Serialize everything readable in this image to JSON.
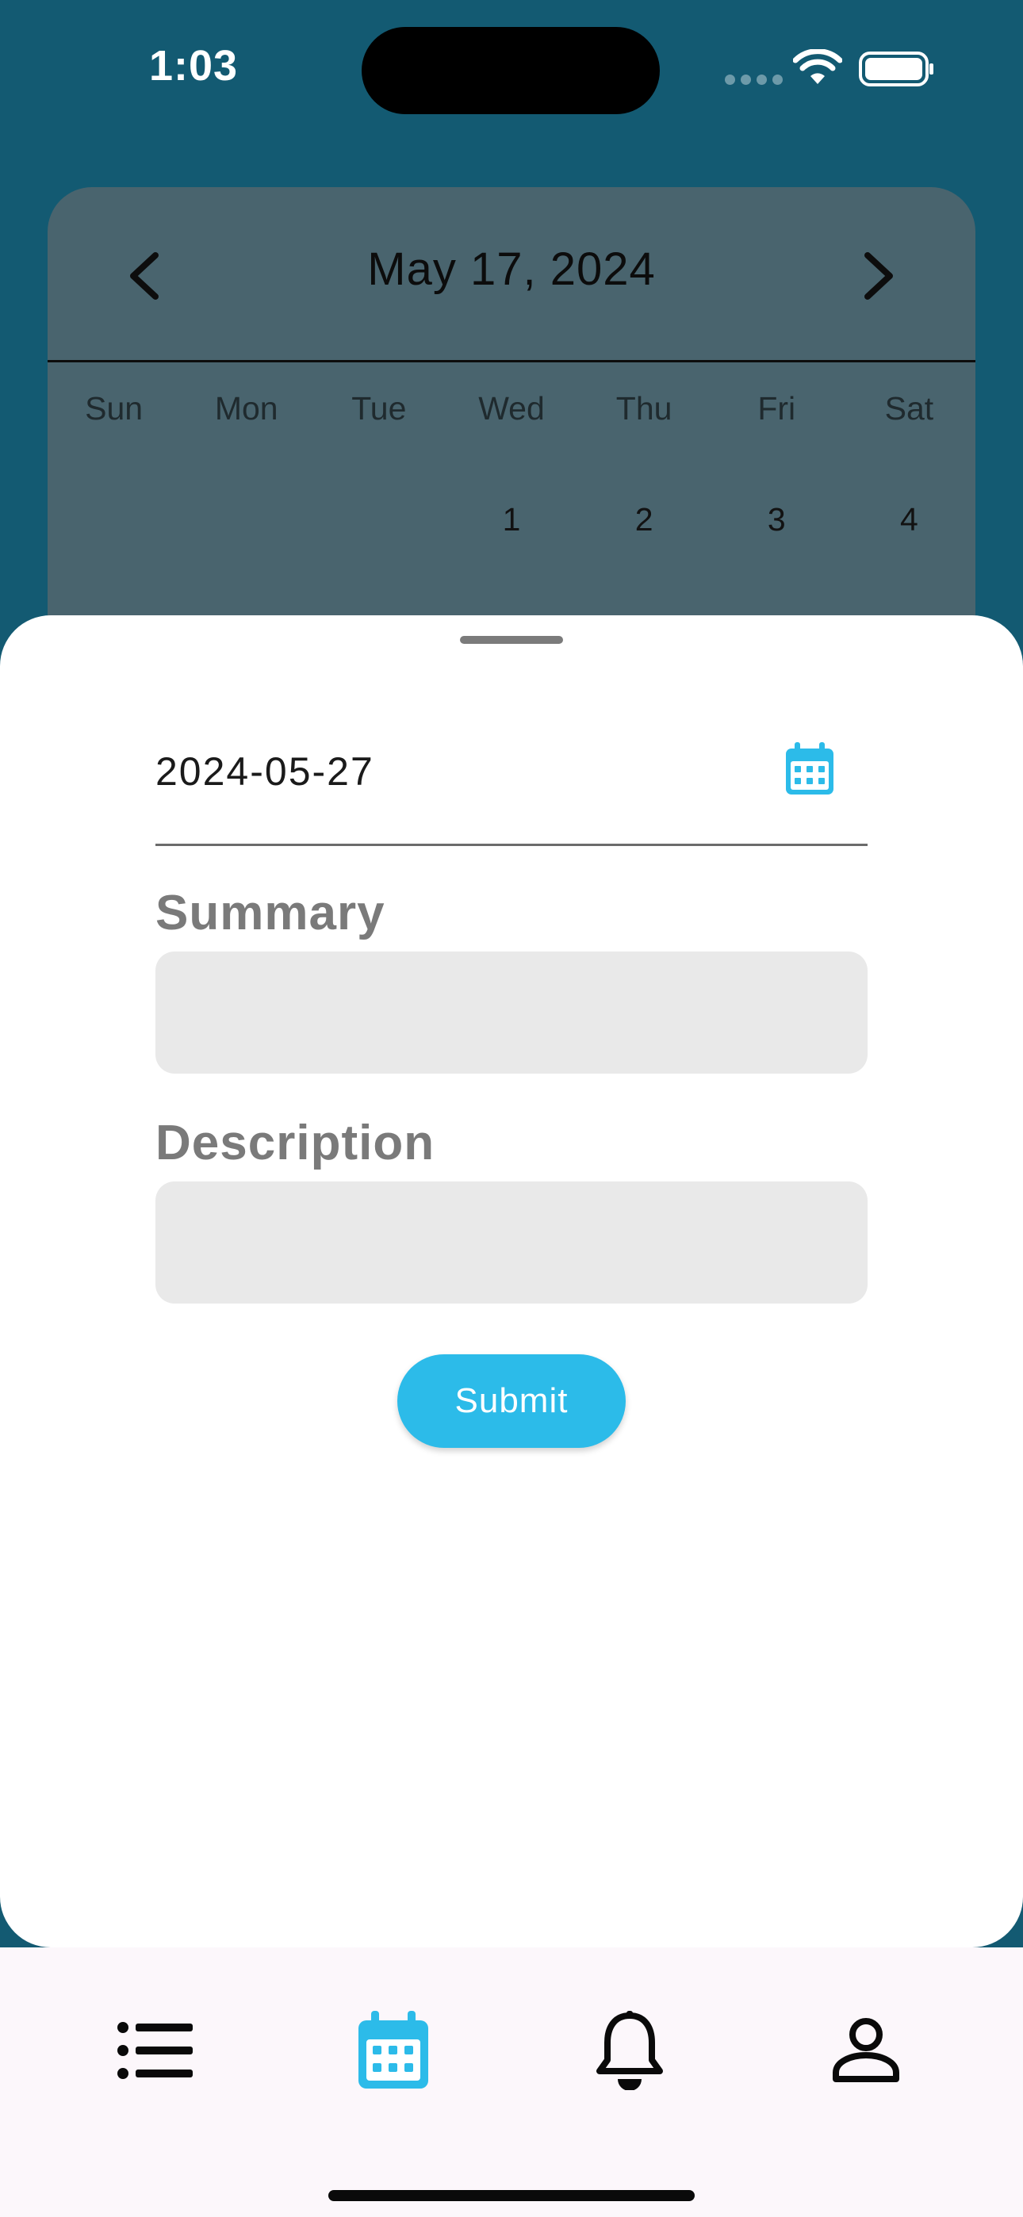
{
  "status_bar": {
    "time": "1:03"
  },
  "calendar": {
    "title": "May 17, 2024",
    "weekdays": [
      "Sun",
      "Mon",
      "Tue",
      "Wed",
      "Thu",
      "Fri",
      "Sat"
    ],
    "first_week": [
      "",
      "",
      "",
      "1",
      "2",
      "3",
      "4"
    ]
  },
  "form": {
    "date_value": "2024-05-27",
    "summary_label": "Summary",
    "summary_value": "",
    "description_label": "Description",
    "description_value": "",
    "submit_label": "Submit"
  },
  "bottom_nav": {
    "items": [
      {
        "icon": "list-icon",
        "active": false
      },
      {
        "icon": "calendar-icon",
        "active": true
      },
      {
        "icon": "bell-icon",
        "active": false
      },
      {
        "icon": "person-icon",
        "active": false
      }
    ]
  },
  "colors": {
    "background": "#135a72",
    "calendar_card": "#49646e",
    "accent": "#2cbbe9",
    "input_fill": "#e9e9e9",
    "nav_background": "#fcf7fb"
  }
}
